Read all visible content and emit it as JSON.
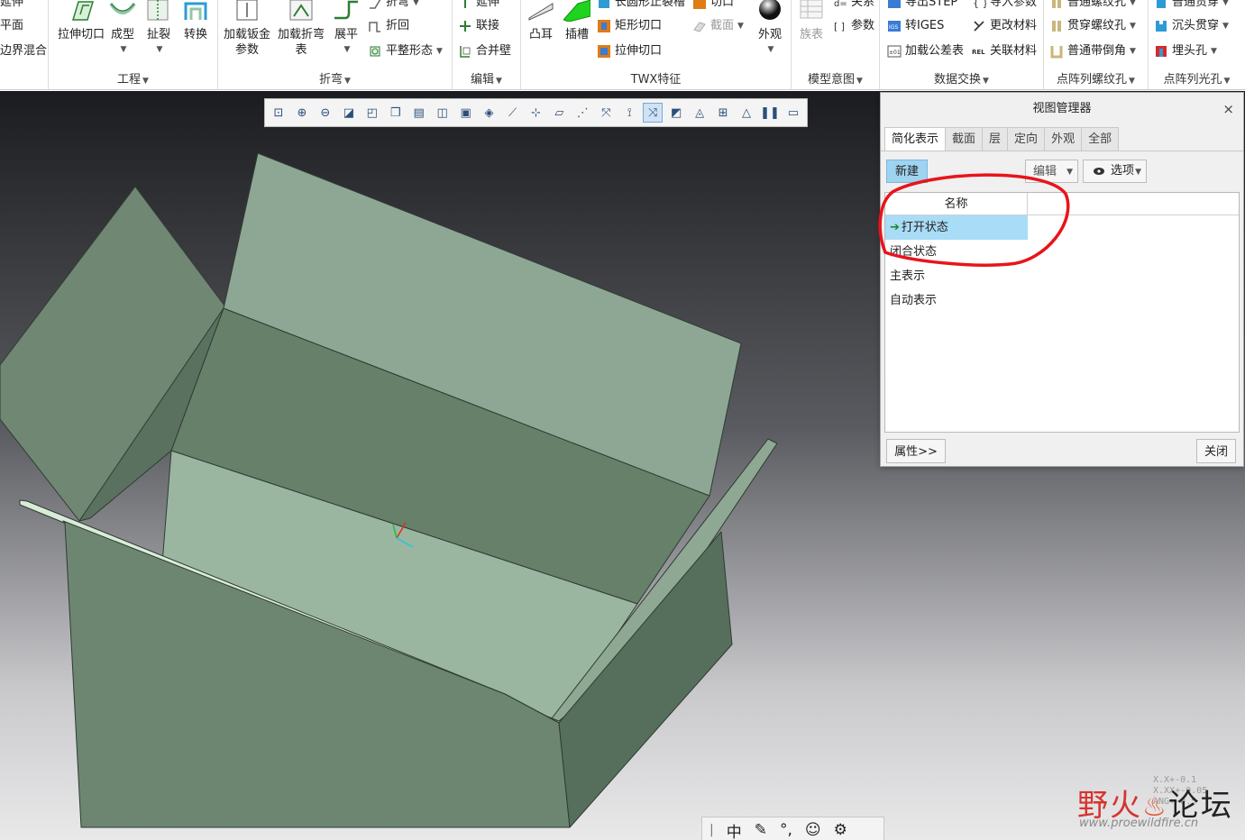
{
  "ribbon": {
    "partial_left": [
      "延伸",
      "平面",
      "边界混合"
    ],
    "engineering": {
      "items": [
        "拉伸切口",
        "成型",
        "扯裂",
        "转换"
      ],
      "label": "工程"
    },
    "bend": {
      "items": [
        "加载钣金\n参数",
        "加载折弯\n表",
        "展平"
      ],
      "small": [
        "折弯",
        "折回",
        "平整形态"
      ],
      "label": "折弯"
    },
    "edit": {
      "small": [
        "延伸",
        "联接",
        "合并壁"
      ],
      "label": "编辑"
    },
    "twx": {
      "big": [
        "凸耳",
        "插槽"
      ],
      "small": [
        "长圆形止裂槽",
        "矩形切口",
        "拉伸切口",
        "切口",
        "截面"
      ],
      "appearance": "外观",
      "label": "TWX特征"
    },
    "model_intent": {
      "big": [
        "族表"
      ],
      "small": [
        "关系",
        "参数"
      ],
      "label": "模型意图"
    },
    "data_exchange": {
      "small": [
        "导出STEP",
        "转IGES",
        "加载公差表",
        "导入参数",
        "更改材料",
        "关联材料"
      ],
      "label": "数据交换"
    },
    "thread_array": {
      "small": [
        "普通螺纹孔",
        "贯穿螺纹孔",
        "普通带倒角"
      ],
      "label": "点阵列螺纹孔"
    },
    "hole_array": {
      "small": [
        "普通贯穿",
        "沉头贯穿",
        "埋头孔"
      ],
      "label": "点阵列光孔"
    }
  },
  "view_manager": {
    "title": "视图管理器",
    "close_icon": "×",
    "tabs": [
      "简化表示",
      "截面",
      "层",
      "定向",
      "外观",
      "全部"
    ],
    "new_button": "新建",
    "edit_button": "编辑",
    "options_button": "选项",
    "column_name": "名称",
    "rows": [
      "打开状态",
      "闭合状态",
      "主表示",
      "自动表示"
    ],
    "selected_row": "打开状态",
    "properties_button": "属性>>",
    "close_button": "关闭"
  },
  "ime": [
    "中",
    "°,"
  ],
  "watermark": {
    "title_part1": "野火",
    "title_part2": "论坛",
    "url": "www.proewildfire.cn",
    "tolerance_text": [
      "X.X+-0.1",
      "X.XX+-0.05",
      "ANG+-0.5"
    ]
  },
  "colors": {
    "annotation_red": "#e8141b",
    "selection_blue": "#a9dcf6",
    "new_button_blue": "#9fd3f0",
    "model_green": "#8aa58f"
  }
}
